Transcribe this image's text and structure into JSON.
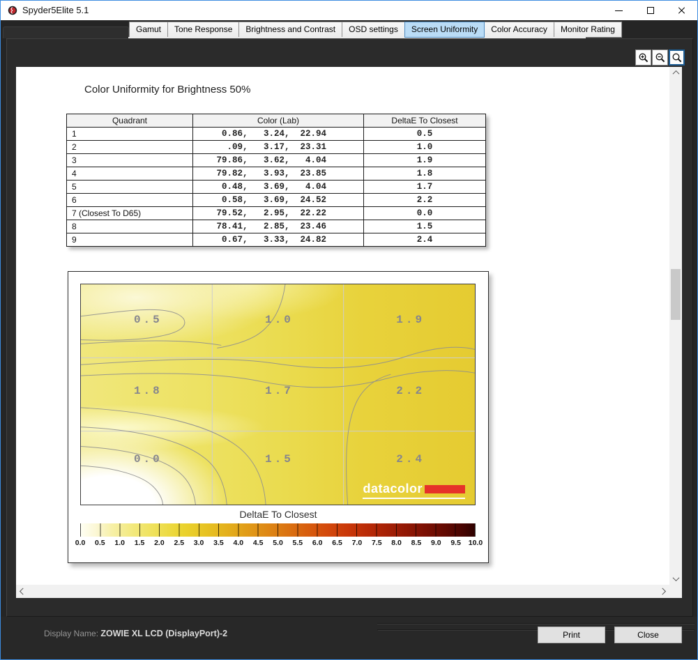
{
  "window": {
    "title": "Spyder5Elite 5.1"
  },
  "icons": {
    "app": "spyder-logo-icon",
    "window": [
      "minimize-icon",
      "maximize-icon",
      "close-icon"
    ],
    "toolbar": [
      "zoom-in-icon",
      "zoom-out-icon",
      "zoom-tool-icon"
    ],
    "scroll": [
      "chevron-up-icon",
      "chevron-down-icon",
      "chevron-left-icon",
      "chevron-right-icon"
    ]
  },
  "tabs": [
    {
      "label": "Gamut",
      "active": false
    },
    {
      "label": "Tone Response",
      "active": false
    },
    {
      "label": "Brightness and Contrast",
      "active": false
    },
    {
      "label": "OSD settings",
      "active": false
    },
    {
      "label": "Screen Uniformity",
      "active": true
    },
    {
      "label": "Color Accuracy",
      "active": false
    },
    {
      "label": "Monitor Rating",
      "active": false
    }
  ],
  "report": {
    "title": "Color Uniformity for Brightness 50%",
    "table": {
      "headers": [
        "Quadrant",
        "Color (Lab)",
        "DeltaE To Closest"
      ],
      "rows": [
        {
          "quadrant": "1",
          "lab": "  0.86,   3.24,  22.94",
          "delta_e": "0.5"
        },
        {
          "quadrant": "2",
          "lab": "   .09,   3.17,  23.31",
          "delta_e": "1.0"
        },
        {
          "quadrant": "3",
          "lab": " 79.86,   3.62,   4.04",
          "delta_e": "1.9"
        },
        {
          "quadrant": "4",
          "lab": " 79.82,   3.93,  23.85",
          "delta_e": "1.8"
        },
        {
          "quadrant": "5",
          "lab": "  0.48,   3.69,   4.04",
          "delta_e": "1.7"
        },
        {
          "quadrant": "6",
          "lab": "  0.58,   3.69,  24.52",
          "delta_e": "2.2"
        },
        {
          "quadrant": "7 (Closest To D65)",
          "lab": " 79.52,   2.95,  22.22",
          "delta_e": "0.0"
        },
        {
          "quadrant": "8",
          "lab": " 78.41,   2.85,  23.46",
          "delta_e": "1.5"
        },
        {
          "quadrant": "9",
          "lab": "  0.67,   3.33,  24.82",
          "delta_e": "2.4"
        }
      ]
    },
    "map": {
      "cells": [
        [
          "0.5",
          "1.0",
          "1.9"
        ],
        [
          "1.8",
          "1.7",
          "2.2"
        ],
        [
          "0.0",
          "1.5",
          "2.4"
        ]
      ],
      "brand": "datacolor",
      "brand_red": "#e63229"
    },
    "scale": {
      "title": "DeltaE To Closest",
      "ticks": [
        "0.0",
        "0.5",
        "1.0",
        "1.5",
        "2.0",
        "2.5",
        "3.0",
        "3.5",
        "4.0",
        "4.5",
        "5.0",
        "5.5",
        "6.0",
        "6.5",
        "7.0",
        "7.5",
        "8.0",
        "8.5",
        "9.0",
        "9.5",
        "10.0"
      ]
    }
  },
  "chart_data": {
    "type": "heatmap",
    "title": "Color Uniformity for Brightness 50%",
    "rows": [
      "top",
      "middle",
      "bottom"
    ],
    "columns": [
      "left",
      "center",
      "right"
    ],
    "values": [
      [
        0.5,
        1.0,
        1.9
      ],
      [
        1.8,
        1.7,
        2.2
      ],
      [
        0.0,
        1.5,
        2.4
      ]
    ],
    "colorbar": {
      "label": "DeltaE To Closest",
      "range": [
        0.0,
        10.0
      ],
      "tick_step": 0.5,
      "colors_low_to_high": [
        "#fffff4",
        "#f2e878",
        "#e7c222",
        "#dc7d13",
        "#d44b0c",
        "#9c1c05",
        "#2e0100"
      ]
    }
  },
  "status": {
    "label": "Display Name:",
    "value": "ZOWIE XL LCD (DisplayPort)-2"
  },
  "actions": {
    "print": "Print",
    "close": "Close"
  },
  "colors": {
    "accent_blue": "#badcf6",
    "window_border": "#3c8ce0",
    "chrome_dark": "#2b2b2b"
  }
}
